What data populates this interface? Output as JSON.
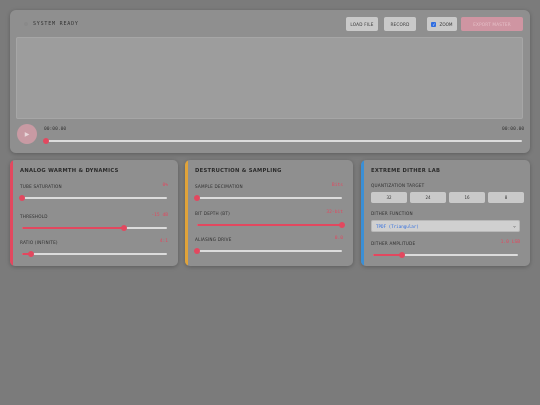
{
  "header": {
    "status": "SYSTEM READY",
    "load_label": "LOAD FILE",
    "record_label": "RECORD",
    "zoom_label": "ZOOM",
    "zoom_checked": true,
    "export_label": "EXPORT MASTER"
  },
  "player": {
    "current_time": "00:00.00",
    "total_time": "00:00.00",
    "position": 0
  },
  "cards": {
    "analog": {
      "title": "ANALOG WARMTH & DYNAMICS",
      "accent": "#e2485f",
      "controls": [
        {
          "label": "TUBE SATURATION",
          "value": "0%",
          "level": 0.0
        },
        {
          "label": "THRESHOLD",
          "value": "-15 dB",
          "level": 0.7
        },
        {
          "label": "RATIO (INFINITE)",
          "value": "4:1",
          "level": 0.06
        }
      ]
    },
    "destruction": {
      "title": "DESTRUCTION & SAMPLING",
      "accent": "#e0a33a",
      "controls": [
        {
          "label": "SAMPLE DECIMATION",
          "value": "Bits",
          "level": 0.0
        },
        {
          "label": "BIT DEPTH (BT)",
          "value": "32-bit",
          "level": 1.0
        },
        {
          "label": "ALIASING DRIVE",
          "value": "0.0",
          "level": 0.0
        }
      ]
    },
    "dither": {
      "title": "EXTREME DITHER LAB",
      "accent": "#3a8fd6",
      "quantization_label": "QUANTIZATION TARGET",
      "quantization_options": [
        "32",
        "24",
        "16",
        "8"
      ],
      "function_label": "DITHER FUNCTION",
      "function_value": "TPDF (Triangular)",
      "amplitude_label": "DITHER AMPLITUDE",
      "amplitude_value": "1.0 LSB",
      "amplitude_level": 0.2
    }
  },
  "colors": {
    "accent_red": "#e2485f",
    "accent_gold": "#e0a33a",
    "accent_blue": "#3a8fd6"
  }
}
